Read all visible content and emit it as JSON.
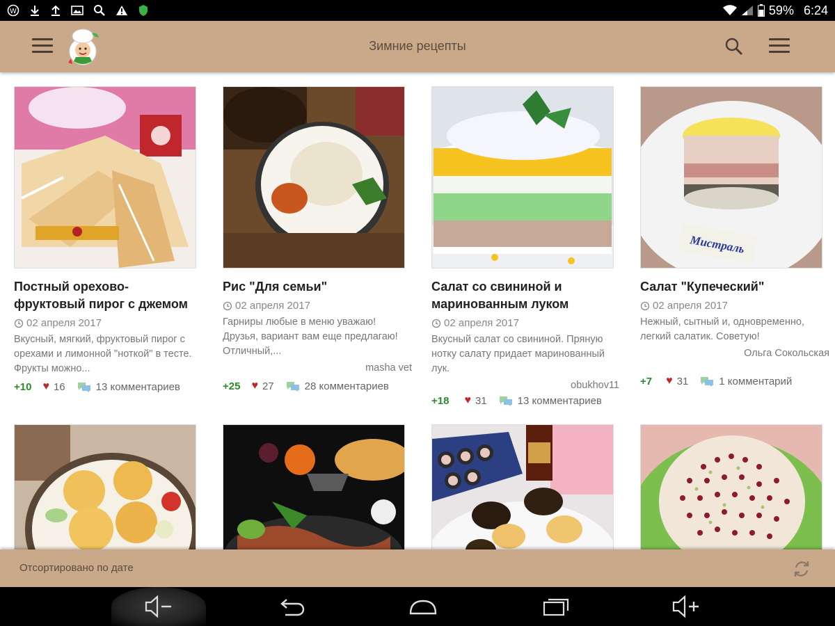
{
  "status_bar": {
    "battery": "59%",
    "time": "6:24"
  },
  "app_bar": {
    "title": "Зимние рецепты"
  },
  "recipes": [
    {
      "title": "Постный орехово-фруктовый пирог с джемом",
      "date": "02 апреля 2017",
      "description": "Вкусный, мягкий, фруктовый пирог с орехами и лимонной \"ноткой\" в тесте. Фрукты можно...",
      "author": "",
      "rating": "+10",
      "likes": "16",
      "comments": "13 комментариев"
    },
    {
      "title": "Рис \"Для семьи\"",
      "date": "02 апреля 2017",
      "description": "Гарниры любые в меню уважаю! Друзья, вариант вам еще предлагаю! Отличный,...",
      "author": "masha vet",
      "rating": "+25",
      "likes": "27",
      "comments": "28 комментариев"
    },
    {
      "title": "Салат со свининой и маринованным луком",
      "date": "02 апреля 2017",
      "description": "Вкусный салат со свининой. Пряную нотку салату придает маринованный лук.",
      "author": "obukhov11",
      "rating": "+18",
      "likes": "31",
      "comments": "13 комментариев"
    },
    {
      "title": "Салат \"Купеческий\"",
      "date": "02 апреля 2017",
      "description": "Нежный, сытный и, одновременно, легкий салатик. Советую!",
      "author": "Ольга Сокольская",
      "rating": "+7",
      "likes": "31",
      "comments": "1 комментарий"
    }
  ],
  "photo_labels": {
    "mistral": "Мистраль"
  },
  "sort_bar": {
    "label": "Отсортировано по дате"
  },
  "colors": {
    "app_bar": "#c9a98a",
    "rating_green": "#2b8a2b",
    "heart_red": "#c0272d"
  }
}
